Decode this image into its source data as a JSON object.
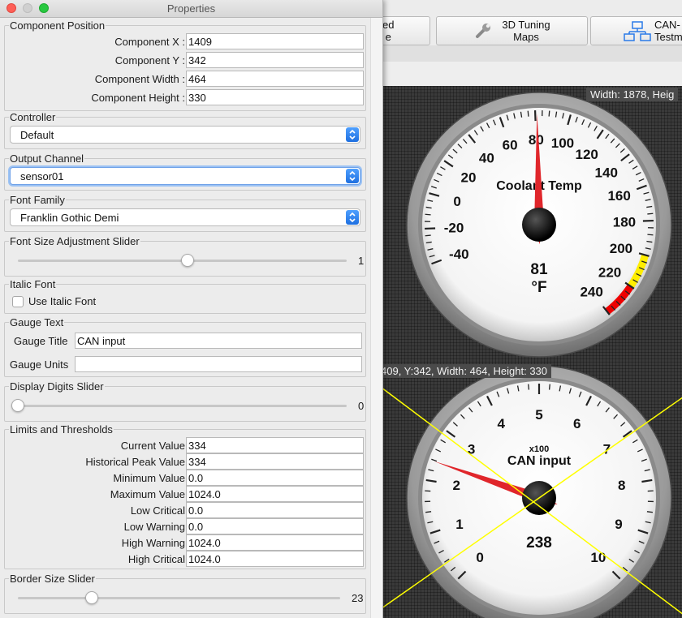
{
  "window": {
    "title": "Properties"
  },
  "component_position": {
    "title": "Component Position",
    "fields": [
      {
        "label": "Component X :",
        "value": "1409"
      },
      {
        "label": "Component Y :",
        "value": "342"
      },
      {
        "label": "Component Width :",
        "value": "464"
      },
      {
        "label": "Component Height :",
        "value": "330"
      }
    ]
  },
  "controller": {
    "title": "Controller",
    "value": "Default"
  },
  "output_channel": {
    "title": "Output Channel",
    "value": "sensor01"
  },
  "font_family": {
    "title": "Font Family",
    "value": "Franklin Gothic Demi"
  },
  "font_size_slider": {
    "title": "Font Size Adjustment Slider",
    "value": "1",
    "fraction": 0.5
  },
  "italic_font": {
    "title": "Italic Font",
    "checkbox_label": "Use Italic Font",
    "checked": false
  },
  "gauge_text": {
    "title": "Gauge Text",
    "title_label": "Gauge Title",
    "title_value": "CAN input",
    "units_label": "Gauge Units",
    "units_value": ""
  },
  "display_digits_slider": {
    "title": "Display Digits Slider",
    "value": "0",
    "fraction": 0.0
  },
  "limits": {
    "title": "Limits and Thresholds",
    "rows": [
      {
        "label": "Current Value",
        "value": "334"
      },
      {
        "label": "Historical Peak Value",
        "value": "334"
      },
      {
        "label": "Minimum Value",
        "value": "0.0"
      },
      {
        "label": "Maximum Value",
        "value": "1024.0"
      },
      {
        "label": "Low Critical",
        "value": "0.0"
      },
      {
        "label": "Low Warning",
        "value": "0.0"
      },
      {
        "label": "High Warning",
        "value": "1024.0"
      },
      {
        "label": "High Critical",
        "value": "1024.0"
      }
    ]
  },
  "border_size_slider": {
    "title": "Border Size Slider",
    "value": "23",
    "fraction": 0.23
  },
  "toolbar": {
    "btn1_line1": "ed",
    "btn1_line2": "e",
    "btn2_line1": "3D Tuning",
    "btn2_line2": "Maps",
    "btn3_line1": "CAN-",
    "btn3_line2": "Testm"
  },
  "dashboard": {
    "info_top": "Width: 1878, Heig",
    "info_selected": "409, Y:342, Width: 464, Height: 330"
  },
  "gauge1": {
    "title": "Coolant Temp",
    "value": "81",
    "units": "°F",
    "value_num": 81,
    "min": -40,
    "max": 240,
    "ticks": [
      "-40",
      "-20",
      "0",
      "20",
      "40",
      "60",
      "80",
      "100",
      "120",
      "140",
      "160",
      "180",
      "200",
      "220",
      "240"
    ],
    "warning_range": [
      200,
      220
    ],
    "critical_range": [
      220,
      240
    ],
    "warning_color": "#ffee00",
    "critical_color": "#ee0000"
  },
  "gauge2": {
    "title": "CAN input",
    "multiplier": "x100",
    "value": "238",
    "value_num": 2.38,
    "min": 0,
    "max": 10,
    "ticks": [
      "0",
      "1",
      "2",
      "3",
      "4",
      "5",
      "6",
      "7",
      "8",
      "9",
      "10"
    ]
  },
  "colors": {
    "needle": "#e0262b",
    "selection_lines": "#ffff00",
    "accent_blue": "#2a7ae8"
  }
}
